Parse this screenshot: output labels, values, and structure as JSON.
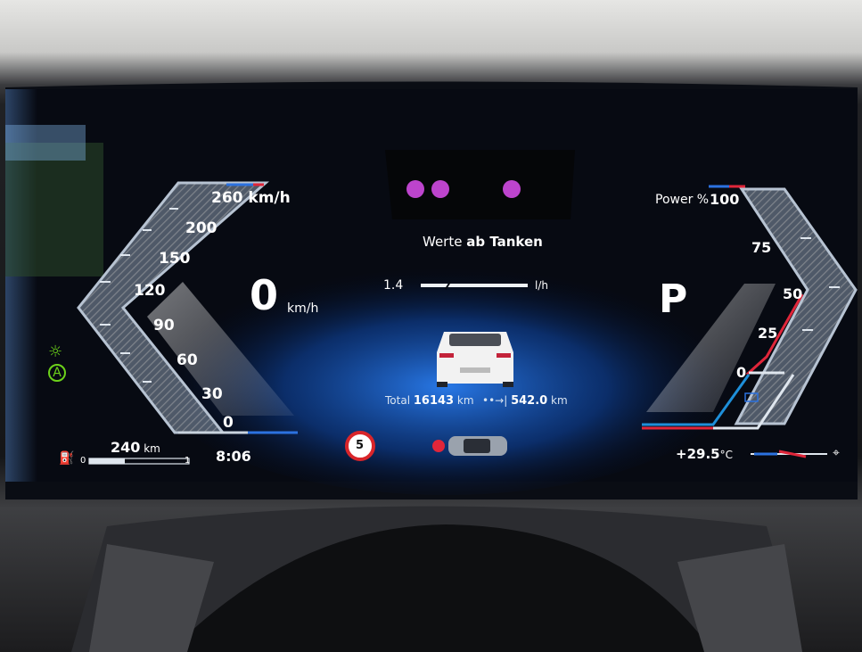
{
  "speedometer": {
    "ticks": [
      "260 km/h",
      "200",
      "150",
      "120",
      "90",
      "60",
      "30",
      "0"
    ],
    "speed_value": "0",
    "speed_unit": "km/h"
  },
  "power_gauge": {
    "label": "Power %",
    "ticks": [
      "100",
      "75",
      "50",
      "25",
      "0"
    ]
  },
  "gear": "P",
  "center": {
    "title_prefix": "Werte",
    "title_emphasis": "ab Tanken",
    "consumption_value": "1.4",
    "consumption_unit": "l/h",
    "total_label": "Total",
    "total_value": "16143",
    "total_unit": "km",
    "trip_value": "542.0",
    "trip_unit": "km"
  },
  "bottom_bar": {
    "range_value": "240",
    "range_unit": "km",
    "fuel_scale_min": "0",
    "fuel_scale_max": "1",
    "clock": "8:06",
    "speed_limit": "5",
    "outside_temp": "+29.5",
    "temp_unit": "°C"
  },
  "colors": {
    "accent_blue": "#1e6fe0",
    "accent_red": "#e0263a",
    "indicator_green": "#6cd21a",
    "speed_limit_ring": "#d9252a"
  },
  "icons": [
    "headlight-icon",
    "auto-high-beam-icon",
    "fuel-pump-icon",
    "seatbelt-warning-icon",
    "car-topview-icon",
    "battery-icon",
    "driving-mode-icon"
  ]
}
